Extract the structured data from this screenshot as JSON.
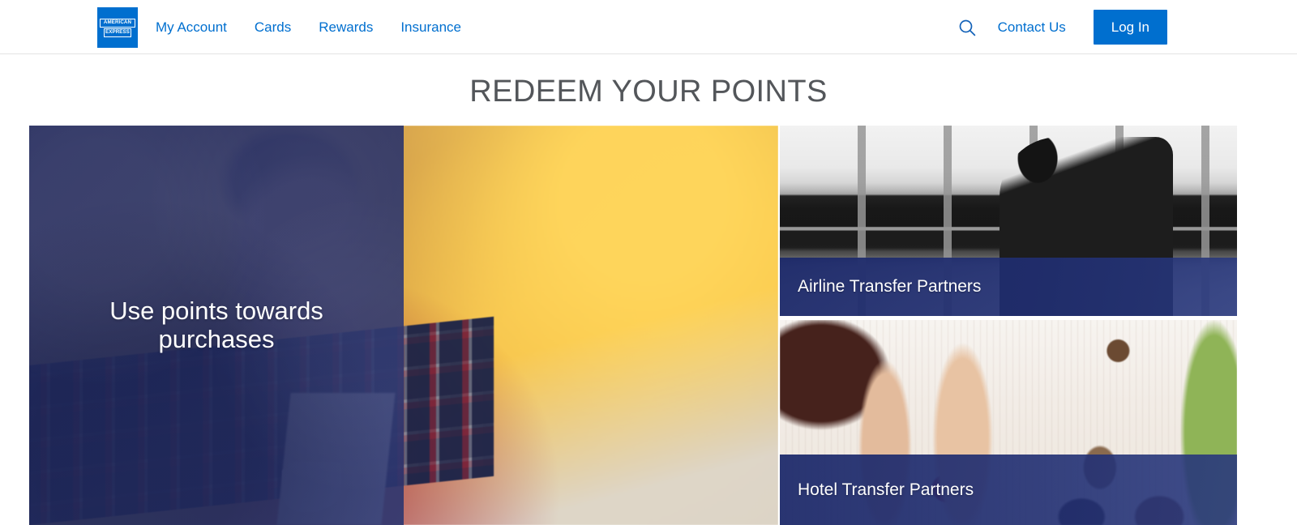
{
  "header": {
    "logo": {
      "name": "american-express-logo",
      "line1": "AMERICAN",
      "line2": "EXPRESS",
      "color": "#006fcf"
    },
    "nav": [
      {
        "label": "My Account"
      },
      {
        "label": "Cards"
      },
      {
        "label": "Rewards"
      },
      {
        "label": "Insurance"
      }
    ],
    "search_icon": "search-icon",
    "contact_label": "Contact Us",
    "login_label": "Log In",
    "link_color": "#006fcf",
    "button_color": "#006fcf"
  },
  "main": {
    "title": "REDEEM YOUR POINTS",
    "title_color": "#53565a",
    "cards": [
      {
        "id": "use-points-towards-purchases",
        "caption": "Use points towards purchases",
        "overlay_color": "#2a3564",
        "image": "man-with-glasses-holding-coffee-at-laptop"
      },
      {
        "id": "airline-transfer-partners",
        "caption": "Airline Transfer Partners",
        "overlay_color": "#1f2d6b",
        "image": "traveler-in-airport-terminal-grayscale"
      },
      {
        "id": "hotel-transfer-partners",
        "caption": "Hotel Transfer Partners",
        "overlay_color": "#1f2d6b",
        "image": "couple-relaxing-on-hotel-bed"
      }
    ]
  }
}
